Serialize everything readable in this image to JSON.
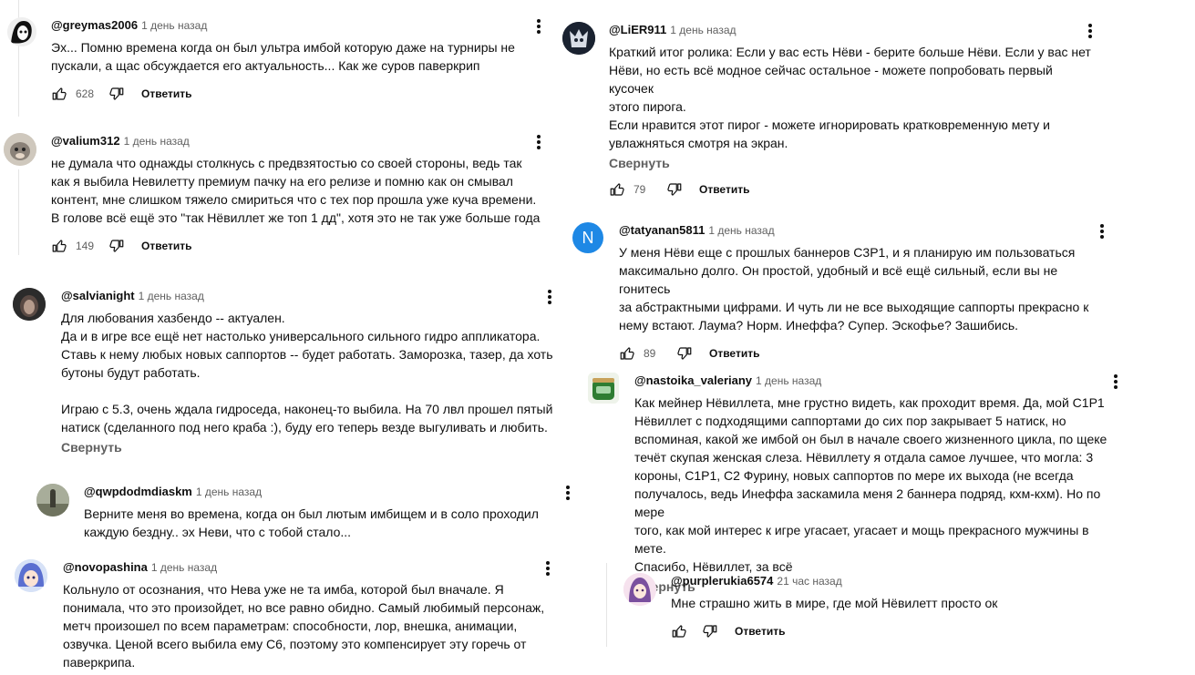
{
  "reply_label": "Ответить",
  "collapse_label": "Свернуть",
  "comments": [
    {
      "author": "@greymas2006",
      "time": "1 день назад",
      "text": "Эх... Помню времена когда он был ультра имбой которую даже на турниры не\nпускали, а щас обсуждается его актуальность... Как же суров паверкрип",
      "likes": "628"
    },
    {
      "author": "@valium312",
      "time": "1 день назад",
      "text": "не думала что однажды столкнусь с предвзятостью со своей стороны, ведь так\nкак я выбила Невилетту премиум пачку на его релизе и помню как он смывал\nконтент, мне слишком тяжело смириться что с тех пор прошла уже куча времени.\nВ голове всё ещё это \"так Нёвиллет же топ 1 дд\", хотя это не так уже больше года",
      "likes": "149"
    },
    {
      "author": "@salvianight",
      "time": "1 день назад",
      "text": "Для любования хазбендо -- актуален.\nДа и в игре все ещё нет настолько универсального сильного гидро аппликатора.\nСтавь к нему любых новых саппортов -- будет работать. Заморозка, тазер, да хоть\nбутоны будут работать.\n\nИграю с 5.3, очень ждала гидроседа, наконец-то выбила. На 70 лвл прошел пятый\nнатиск (сделанного под него краба :), буду его теперь везде выгуливать и любить."
    },
    {
      "author": "@qwpdodmdiaskm",
      "time": "1 день назад",
      "text": "Верните меня во времена, когда он был лютым имбищем и в соло проходил\nкаждую бездну.. эх Неви, что с тобой стало..."
    },
    {
      "author": "@novopashina",
      "time": "1 день назад",
      "text": "Кольнуло от осознания, что Нева уже не та имба, которой был вначале. Я\nпонимала, что это произойдет, но все равно обидно. Самый любимый персонаж,\nметч произошел по всем параметрам: способности, лор, внешка, анимации,\nозвучка. Ценой всего выбила ему С6, поэтому это компенсирует эту горечь от\nпаверкрипа."
    },
    {
      "author": "@LiER911",
      "time": "1 день назад",
      "text": "Краткий итог ролика: Если у вас есть Нёви - берите больше Нёви. Если у вас нет\nНёви, но есть всё модное сейчас остальное - можете попробовать первый кусочек\nэтого пирога.\nЕсли нравится этот пирог - можете игнорировать кратковременную мету и\nувлажняться смотря на экран.",
      "likes": "79"
    },
    {
      "author": "@tatyanan5811",
      "time": "1 день назад",
      "avatar_letter": "N",
      "text": "У меня Нёви еще с прошлых баннеров С3Р1, и я планирую им пользоваться\nмаксимально долго. Он простой, удобный и всё ещё сильный, если вы не гонитесь\nза абстрактными цифрами. И чуть ли не все выходящие саппорты прекрасно к\nнему встают. Лаума? Норм. Инеффа? Супер. Эскофье? Зашибись.",
      "likes": "89"
    },
    {
      "author": "@nastoika_valeriany",
      "time": "1 день назад",
      "text": "Как мейнер Нёвиллета, мне грустно видеть, как проходит время. Да, мой С1Р1\nНёвиллет с подходящими саппортами до сих пор закрывает 5 натиск, но\nвспоминая, какой же имбой он был в начале своего жизненного цикла, по щеке\nтечёт скупая женская слеза. Нёвиллету я отдала самое лучшее, что могла: 3\nкороны, С1Р1, С2 Фурину, новых саппортов по мере их выхода (не всегда\nполучалось, ведь Инеффа заскамила меня 2 баннера подряд, кхм-кхм). Но по мере\nтого, как мой интерес к игре угасает, угасает и мощь прекрасного мужчины в мете.\nСпасибо, Нёвиллет, за всё"
    },
    {
      "author": "@purplerukia6574",
      "time": "21 час назад",
      "text": "Мне страшно жить в мире, где мой Нёвилетт просто ок"
    }
  ]
}
